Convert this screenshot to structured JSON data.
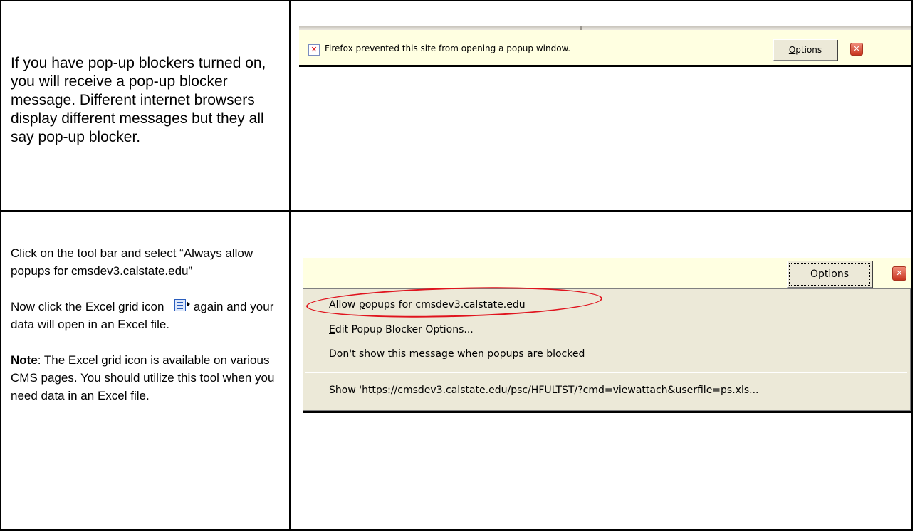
{
  "row1": {
    "instruction_text": "If you have pop-up blockers turned on, you will receive a pop-up blocker message. Different internet browsers display different messages but they all say pop-up blocker.",
    "firefox_bar": {
      "message": "Firefox prevented this site from opening a popup window.",
      "options_label": "Options",
      "options_underline": "O",
      "options_rest": "ptions"
    }
  },
  "row2": {
    "instruction_1": "Click on the tool bar and select “Always allow popups for cmsdev3.calstate.edu”",
    "instruction_2_before_icon": "Now click the Excel grid icon",
    "instruction_2_after_icon": "again and your data will open in an Excel file.",
    "note_label": "Note",
    "note_text": ": The Excel grid icon is available on various CMS pages. You should utilize this tool when you need data in an Excel file.",
    "options_bar": {
      "options_underline": "O",
      "options_rest": "ptions"
    },
    "menu": {
      "item1_pre": "Allow ",
      "item1_key": "p",
      "item1_post": "opups for cmsdev3.calstate.edu",
      "item2_key": "E",
      "item2_post": "dit Popup Blocker Options...",
      "item3_key": "D",
      "item3_post": "on't show this message when popups are blocked",
      "item4": "Show 'https://cmsdev3.calstate.edu/psc/HFULTST/?cmd=viewattach&userfile=ps.xls..."
    }
  },
  "icons": {
    "blocked_popup": "blocked-popup-icon",
    "close": "close-icon",
    "excel_grid": "excel-grid-icon"
  },
  "colors": {
    "notification_bar": "#ffffe1",
    "menu_bg": "#ece9d8",
    "highlight_ring": "#e0141e"
  }
}
